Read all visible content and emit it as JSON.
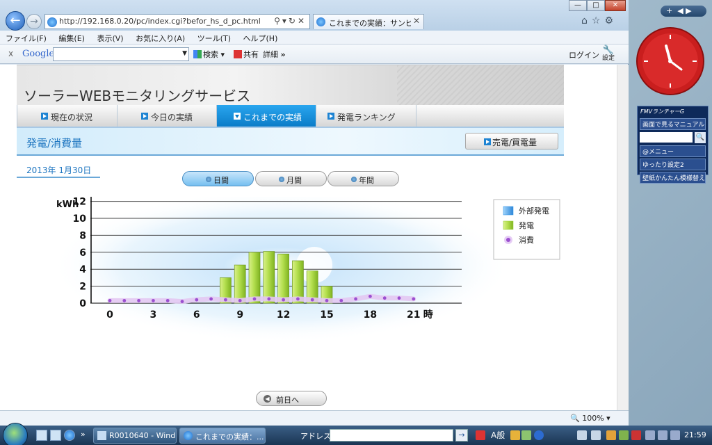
{
  "browser": {
    "url": "http://192.168.0.20/pc/index.cgi?befor_hs_d_pc.html",
    "tab_title": "これまでの実績：サンピ...",
    "menu": [
      "ファイル(F)",
      "編集(E)",
      "表示(V)",
      "お気に入り(A)",
      "ツール(T)",
      "ヘルプ(H)"
    ],
    "zoom": "100%"
  },
  "google_toolbar": {
    "close": "x",
    "logo": "Google",
    "search_label": "検索",
    "share_label": "共有",
    "detail_label": "詳細",
    "more": "»",
    "login": "ログイン",
    "settings": "設定"
  },
  "service": {
    "title": "ソーラーWEBモニタリングサービス",
    "tabs": [
      "現在の状況",
      "今日の実績",
      "これまでの実績",
      "発電ランキング"
    ],
    "section_title": "発電/消費量",
    "sales_button": "売電/買電量",
    "date": "2013年 1月30日",
    "periods": [
      "日間",
      "月間",
      "年間"
    ],
    "prev_button": "前日へ"
  },
  "chart_data": {
    "type": "bar",
    "ylabel": "kWh",
    "xlabel": "時",
    "ylim": [
      0,
      12
    ],
    "yticks": [
      0,
      2,
      4,
      6,
      8,
      10,
      12
    ],
    "xticks": [
      0,
      3,
      6,
      9,
      12,
      15,
      18,
      21
    ],
    "legend": [
      "外部発電",
      "発電",
      "消費"
    ],
    "legend_colors": [
      "#3d9be8",
      "#9bd23c",
      "#9b4fd0"
    ],
    "generation": {
      "hours": [
        8,
        9,
        10,
        11,
        12,
        13,
        14,
        15
      ],
      "values": [
        3.0,
        4.5,
        6.0,
        6.1,
        5.8,
        5.0,
        3.8,
        2.0
      ]
    },
    "consumption": {
      "hours": [
        0,
        1,
        2,
        3,
        4,
        5,
        6,
        7,
        8,
        9,
        10,
        11,
        12,
        13,
        14,
        15,
        16,
        17,
        18,
        19,
        20,
        21
      ],
      "values": [
        0.3,
        0.3,
        0.3,
        0.3,
        0.3,
        0.2,
        0.4,
        0.5,
        0.4,
        0.3,
        0.5,
        0.5,
        0.4,
        0.5,
        0.4,
        0.3,
        0.3,
        0.5,
        0.8,
        0.6,
        0.6,
        0.5
      ]
    }
  },
  "taskbar": {
    "task1": "R0010640 - Wind...",
    "task2": "これまでの実績：...",
    "address_label": "アドレス",
    "ime": "A般",
    "time": "21:59"
  },
  "sidebar": {
    "fmv_title": "FMVランチャーG",
    "fmv_links": [
      "画面で見るマニュアル",
      "@メニュー",
      "ゆったり設定2",
      "壁紙かんたん模様替え"
    ]
  }
}
